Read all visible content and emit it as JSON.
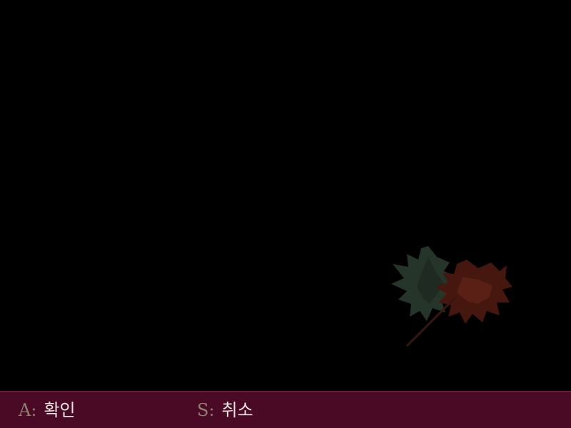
{
  "scene": {
    "background": "#000000",
    "decoration_icon": "maple-leaves-icon",
    "leaf_colors": {
      "green": "#2a3a2c",
      "red": "#4a1a14"
    }
  },
  "hint_bar": {
    "background": "#4a0a26",
    "confirm": {
      "key": "A",
      "separator": ":",
      "label": "확인"
    },
    "cancel": {
      "key": "S",
      "separator": ":",
      "label": "취소"
    },
    "key_color": "#8f7f6e",
    "label_color": "#e9e5df"
  }
}
